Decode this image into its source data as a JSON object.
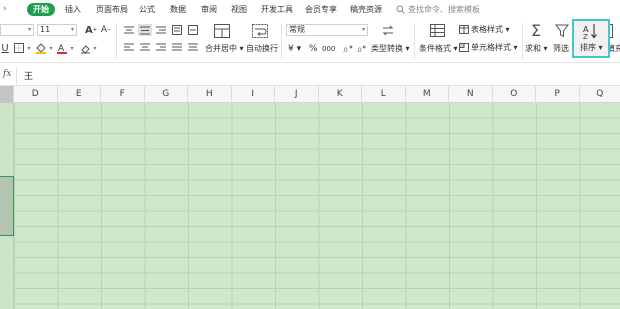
{
  "menu": {
    "tabs": [
      {
        "label": "开始",
        "active": true
      },
      {
        "label": "插入"
      },
      {
        "label": "页面布局"
      },
      {
        "label": "公式"
      },
      {
        "label": "数据"
      },
      {
        "label": "审阅"
      },
      {
        "label": "视图"
      },
      {
        "label": "开发工具"
      },
      {
        "label": "会员专享"
      },
      {
        "label": "稿壳资源"
      }
    ],
    "search_placeholder": "查找命令、搜索模板"
  },
  "ribbon": {
    "font_size": "11",
    "number_format": "常规",
    "merge_label": "合并居中",
    "wrap_label": "自动换行",
    "convert_label": "类型转换",
    "cond_format_label": "条件格式",
    "table_style_label": "表格样式",
    "cell_style_label": "单元格样式",
    "sum_label": "求和",
    "filter_label": "筛选",
    "sort_label": "排序",
    "fill_label": "填充",
    "currency_symbol": "¥",
    "percent_symbol": "%",
    "thousands_symbol": "000",
    "sum_symbol": "Σ",
    "font_color": "#d32f2f",
    "fill_color": "#f4c400",
    "highlight_color": "#41c7d2"
  },
  "formula_bar": {
    "fx_label": "fx",
    "value": "王"
  },
  "grid": {
    "columns": [
      "D",
      "E",
      "F",
      "G",
      "H",
      "I",
      "J",
      "K",
      "L",
      "M",
      "N",
      "O",
      "P",
      "Q"
    ],
    "cell_fill": "#cfe8c9"
  }
}
